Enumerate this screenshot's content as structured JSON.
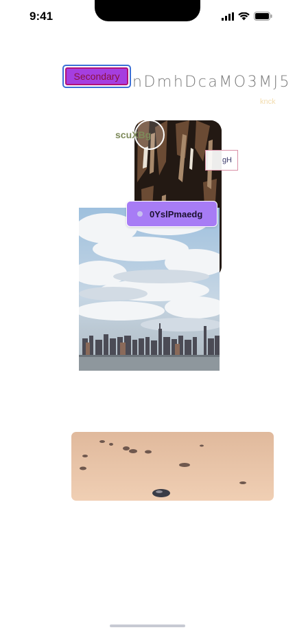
{
  "status_bar": {
    "time": "9:41"
  },
  "secondary_button": {
    "label": "Secondary"
  },
  "heading": {
    "text": "nDmhDcaMO3MJ5"
  },
  "faint_label": "knck",
  "olive_label": "scuXBg",
  "small_box": {
    "label": "gH"
  },
  "chip": {
    "label": "0YslPmaedg"
  },
  "colors": {
    "chip": "#a77cf5",
    "button_fill": "#a53ee0",
    "button_focus": "#3b6fd6"
  }
}
